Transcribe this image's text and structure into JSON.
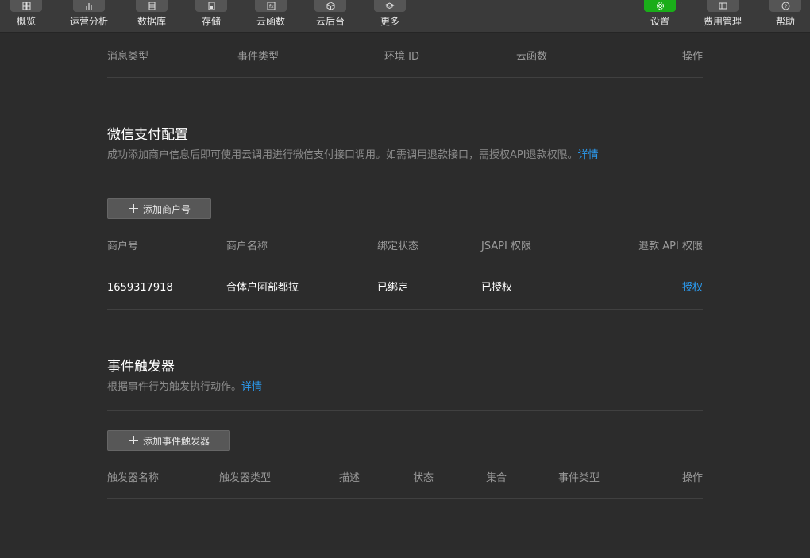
{
  "toolbar": {
    "left_items": [
      {
        "label": "概览",
        "icon": "dashboard-icon"
      },
      {
        "label": "运营分析",
        "icon": "bar-chart-icon"
      },
      {
        "label": "数据库",
        "icon": "database-icon"
      },
      {
        "label": "存储",
        "icon": "storage-icon"
      },
      {
        "label": "云函数",
        "icon": "function-icon"
      },
      {
        "label": "云后台",
        "icon": "cube-icon"
      },
      {
        "label": "更多",
        "icon": "layers-icon"
      }
    ],
    "right_items": [
      {
        "label": "设置",
        "icon": "gear-icon"
      },
      {
        "label": "费用管理",
        "icon": "billing-icon"
      },
      {
        "label": "帮助",
        "icon": "help-icon"
      }
    ],
    "active_color": "#1aad19"
  },
  "message_table": {
    "headers": [
      "消息类型",
      "事件类型",
      "环境 ID",
      "云函数",
      "操作"
    ]
  },
  "wxpay": {
    "title": "微信支付配置",
    "desc": "成功添加商户信息后即可使用云调用进行微信支付接口调用。如需调用退款接口，需授权API退款权限。",
    "desc_link": "详情",
    "add_button": "添加商户号",
    "headers": [
      "商户号",
      "商户名称",
      "绑定状态",
      "JSAPI 权限",
      "退款 API 权限"
    ],
    "rows": [
      {
        "merchant_id": "1659317918",
        "merchant_name": "合体户阿部都拉",
        "bind_status": "已绑定",
        "jsapi": "已授权",
        "refund_action": "授权"
      }
    ]
  },
  "triggers": {
    "title": "事件触发器",
    "desc": "根据事件行为触发执行动作。",
    "desc_link": "详情",
    "add_button": "添加事件触发器",
    "headers": [
      "触发器名称",
      "触发器类型",
      "描述",
      "状态",
      "集合",
      "事件类型",
      "操作"
    ]
  },
  "colors": {
    "background": "#2c2c2c",
    "toolbar": "#3a3a3a",
    "link": "#2b9cf2",
    "accent": "#1aad19"
  }
}
